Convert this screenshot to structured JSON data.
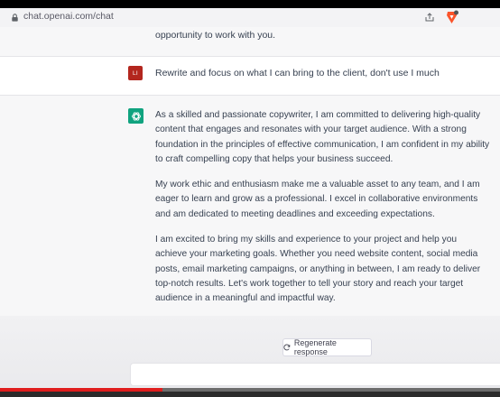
{
  "browser": {
    "url": "chat.openai.com/chat",
    "icons": [
      "lock-icon",
      "share-icon",
      "brave-icon"
    ]
  },
  "chat": {
    "previous_tail": "opportunity to work with you.",
    "user_message": {
      "avatar_initials": "LI",
      "text": "Rewrite and focus on what I can bring to the client, don't use I much"
    },
    "assistant_message": {
      "paragraphs": [
        "As a skilled and passionate copywriter, I am committed to delivering high-quality content that engages and resonates with your target audience. With a strong foundation in the principles of effective communication, I am confident in my ability to craft compelling copy that helps your business succeed.",
        "My work ethic and enthusiasm make me a valuable asset to any team, and I am eager to learn and grow as a professional. I excel in collaborative environments and am dedicated to meeting deadlines and exceeding expectations.",
        "I am excited to bring my skills and experience to your project and help you achieve your marketing goals. Whether you need website content, social media posts, email marketing campaigns, or anything in between, I am ready to deliver top-notch results. Let's work together to tell your story and reach your target audience in a meaningful and impactful way."
      ]
    },
    "regenerate_label": "Regenerate response"
  },
  "video": {
    "progress_fraction": 0.325
  },
  "colors": {
    "user_avatar": "#b3261e",
    "assistant_avatar": "#10a37f",
    "progress": "#e01e1e"
  }
}
